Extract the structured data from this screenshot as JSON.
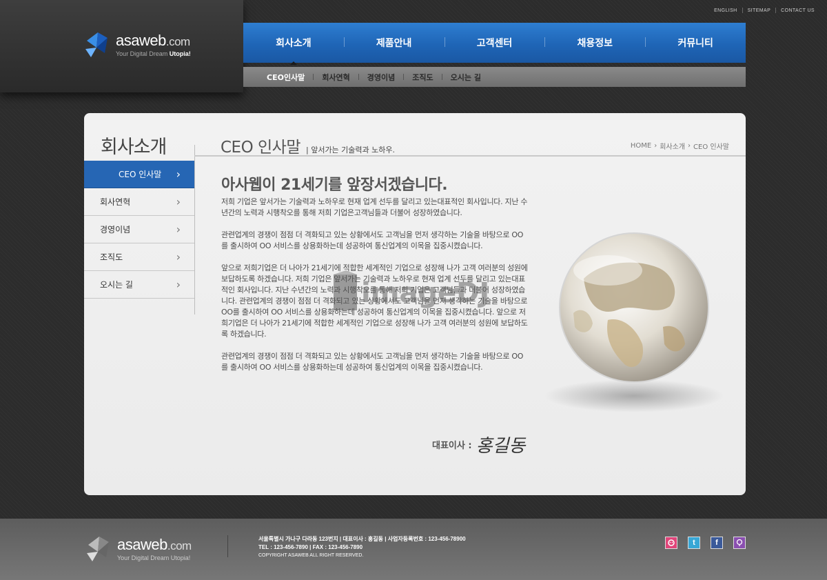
{
  "logo": {
    "name": "asaweb",
    "tld": ".com",
    "slogan_pre": "Your Digital Dream ",
    "slogan_bold": "Utopia!"
  },
  "util_links": [
    "ENGLISH",
    "SITEMAP",
    "CONTACT US"
  ],
  "main_nav": [
    "회사소개",
    "제품안내",
    "고객센터",
    "채용정보",
    "커뮤니티"
  ],
  "sub_nav": [
    "CEO인사말",
    "회사연혁",
    "경영이념",
    "조직도",
    "오시는 길"
  ],
  "side": {
    "title": "회사소개",
    "items": [
      "CEO 인사말",
      "회사연혁",
      "경영이념",
      "조직도",
      "오시는 길"
    ]
  },
  "page": {
    "title": "CEO 인사말",
    "desc": "| 앞서가는 기술력과 노하우.",
    "breadcrumb": [
      "HOME",
      "회사소개",
      "CEO 인사말"
    ],
    "headline": "아사웹이 21세기를 앞장서겠습니다.",
    "paragraphs": [
      "저희 기업은 앞서가는 기술력과 노하우로 현재 업계 선두를 달리고 있는대표적인 회사입니다. 지난 수년간의 노력과 시행착오를 통해 저희 기업은고객님들과 더불어 성장하였습니다.",
      "관련업계의 경쟁이 점점 더 격화되고 있는 상황에서도 고객님을 먼저 생각하는 기술을 바탕으로 OO를 출시하여 OO 서비스를 상용화하는데 성공하여 통신업계의 이목을 집중시켰습니다.",
      "앞으로 저희기업은 더 나아가 21세기에 적합한 세계적인 기업으로 성장해 나가 고객 여러분의 성원에 보답하도록 하겠습니다. 저희 기업은 앞서가는 기술력과 노하우로 현재 업계 선두를 달리고 있는대표적인 회사입니다. 지난 수년간의 노력과 시행착오를 통해 저희 기업은 고객님들과 더불어 성장하였습니다. 관련업계의 경쟁이 점점 더 격화되고 있는 상황에서도 고객님을 먼저 생각하는 기술을 바탕으로 OO를 출시하여 OO 서비스를 상용화하는데 성공하여 통신업계의 이목을 집중시켰습니다. 앞으로 저희기업은 더 나아가 21세기에 적합한 세계적인 기업으로 성장해 나가 고객 여러분의 성원에 보답하도록 하겠습니다.",
      "관련업계의 경쟁이 점점 더 격화되고 있는 상황에서도 고객님을 먼저 생각하는 기술을 바탕으로 OO를 출시하여 OO 서비스를 상용화하는데 성공하여 통신업계의 이목을 집중시켰습니다."
    ],
    "sign_label": "대표이사 :",
    "sign_name": "홍길동"
  },
  "watermark": "imageDJ",
  "footer": {
    "line1": "서울특별시 가나구 다라동 123번지  |  대표이사 : 홍길동  |  사업자등록번호 : 123-456-78900",
    "line2": "TEL : 123-456-7890  |  FAX : 123-456-7890",
    "copyright": "COPYRIGHT ASAWEB ALL RIGHT RESERVED."
  },
  "sns": [
    {
      "name": "me2day-icon",
      "color": "#e0457a"
    },
    {
      "name": "twitter-icon",
      "color": "#38a7d6"
    },
    {
      "name": "facebook-icon",
      "color": "#3b5a9a"
    },
    {
      "name": "blog-icon",
      "color": "#8a4fb0"
    }
  ],
  "colors": {
    "accent": "#2666b4",
    "nav_blue": "#1f65b6"
  }
}
